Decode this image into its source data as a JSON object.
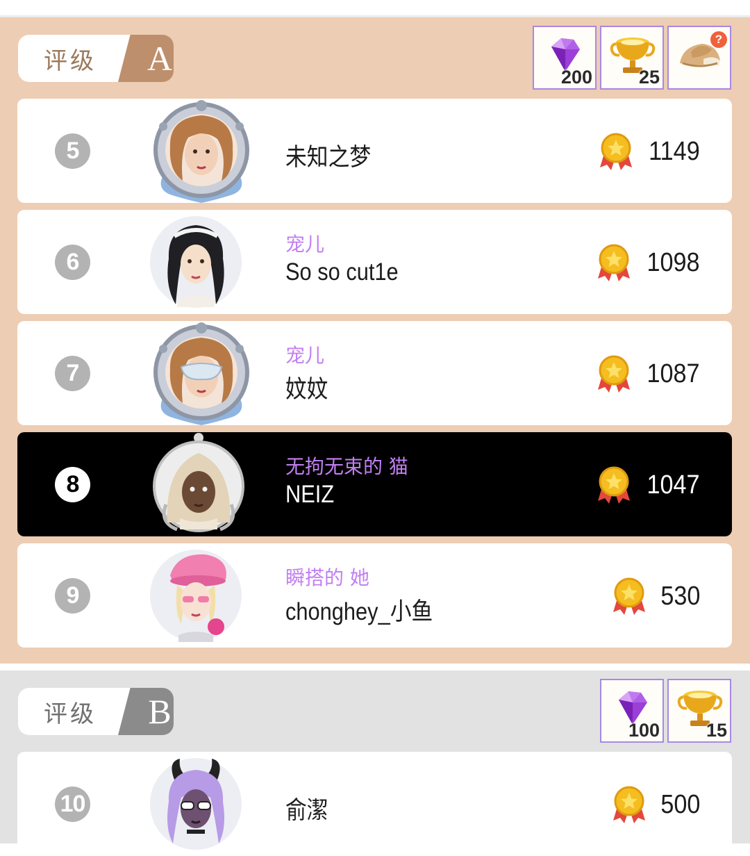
{
  "colors": {
    "section_a_bg": "#edcdb3",
    "section_b_bg": "#e2e2e2",
    "highlight_row_bg": "#000000",
    "title_purple": "#c27ff2",
    "reward_border": "#a889e2"
  },
  "section_a": {
    "grade_label": "评级",
    "grade_letter": "A",
    "rewards": [
      {
        "icon": "diamond-icon",
        "count": "200"
      },
      {
        "icon": "trophy-icon",
        "count": "25"
      },
      {
        "icon": "hat-icon",
        "count": "",
        "badge": "?"
      }
    ],
    "rows": [
      {
        "rank": "5",
        "title": "",
        "name": "未知之梦",
        "score": "1149",
        "avatar": "framed-avatar-woman"
      },
      {
        "rank": "6",
        "title": "宠儿",
        "name": "So so cut1e",
        "score": "1098",
        "avatar": "avatar-woman-black-hair"
      },
      {
        "rank": "7",
        "title": "宠儿",
        "name": "妏妏",
        "score": "1087",
        "avatar": "framed-avatar-masked-woman"
      },
      {
        "rank": "8",
        "title": "无拘无束的 猫",
        "name": "NEIZ",
        "score": "1047",
        "avatar": "avatar-hooded-woman",
        "is_current_user": true
      },
      {
        "rank": "9",
        "title": "瞬搭的 她",
        "name": "chonghey_小鱼",
        "score": "530",
        "avatar": "avatar-pink-beret"
      }
    ]
  },
  "section_b": {
    "grade_label": "评级",
    "grade_letter": "B",
    "rewards": [
      {
        "icon": "diamond-icon",
        "count": "100"
      },
      {
        "icon": "trophy-icon",
        "count": "15"
      }
    ],
    "rows": [
      {
        "rank": "10",
        "title": "",
        "name": "俞潔",
        "score": "500",
        "avatar": "avatar-purple-hair"
      }
    ]
  }
}
